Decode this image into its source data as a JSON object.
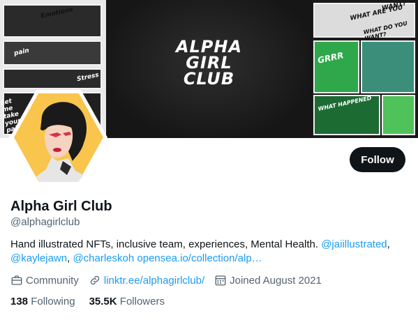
{
  "banner": {
    "logo_lines": [
      "ALPHA",
      "GIRL",
      "CLUB"
    ],
    "left_texts": [
      "Emotions",
      "pain",
      "Stress",
      "Let me take your pain away"
    ],
    "right_texts": [
      "WHAT ARE YOU",
      "WANT?",
      "WHAT DO YOU WANT?",
      "GRRR",
      "WHAT HAPPENED"
    ]
  },
  "colors": {
    "avatar_bg": "#f9c54d",
    "follow_bg": "#0f1419",
    "link": "#1d9bf0",
    "muted": "#536471"
  },
  "profile": {
    "display_name": "Alpha Girl Club",
    "handle": "@alphagirlclub",
    "bio": {
      "text1": "Hand illustrated NFTs, inclusive team, experiences, Mental Health.",
      "mention1": "@jaiillustrated",
      "sep1": ",",
      "mention2": "@kaylejawn",
      "sep2": ",",
      "mention3": "@charleskoh",
      "link": "opensea.io/collection/alp…"
    },
    "category": "Community",
    "website": "linktr.ee/alphagirlclub/",
    "joined": "Joined August 2021",
    "following_count": "138",
    "following_label": "Following",
    "followers_count": "35.5K",
    "followers_label": "Followers"
  },
  "actions": {
    "follow_label": "Follow"
  },
  "icons": {
    "category": "briefcase-icon",
    "website": "link-icon",
    "joined": "calendar-icon"
  }
}
